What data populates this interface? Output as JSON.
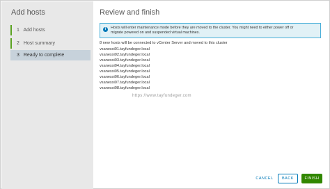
{
  "wizard": {
    "title": "Add hosts",
    "steps": [
      {
        "num": "1",
        "label": "Add hosts"
      },
      {
        "num": "2",
        "label": "Host summary"
      },
      {
        "num": "3",
        "label": "Ready to complete"
      }
    ]
  },
  "page": {
    "title": "Review and finish",
    "info_line1": "Hosts will enter maintenance mode before they are moved to the cluster. You might need to either power off or",
    "info_line2": "migrate powered on and suspended virtual machines.",
    "summary": "8 new hosts will be connected to vCenter Server and moved to this cluster",
    "hosts": [
      "vsanesxi01.tayfundeger.local",
      "vsanesxi02.tayfundeger.local",
      "vsanesxi03.tayfundeger.local",
      "vsanesxi04.tayfundeger.local",
      "vsanesxi05.tayfundeger.local",
      "vsanesxi06.tayfundeger.local",
      "vsanesxi07.tayfundeger.local",
      "vsanesxi08.tayfundeger.local"
    ],
    "watermark": "https://www.tayfundeger.com"
  },
  "footer": {
    "cancel": "CANCEL",
    "back": "BACK",
    "finish": "FINISH"
  },
  "colors": {
    "accent": "#0079b8",
    "success": "#318700",
    "step_done": "#5aa220",
    "info_bg": "#e1f1f6"
  }
}
